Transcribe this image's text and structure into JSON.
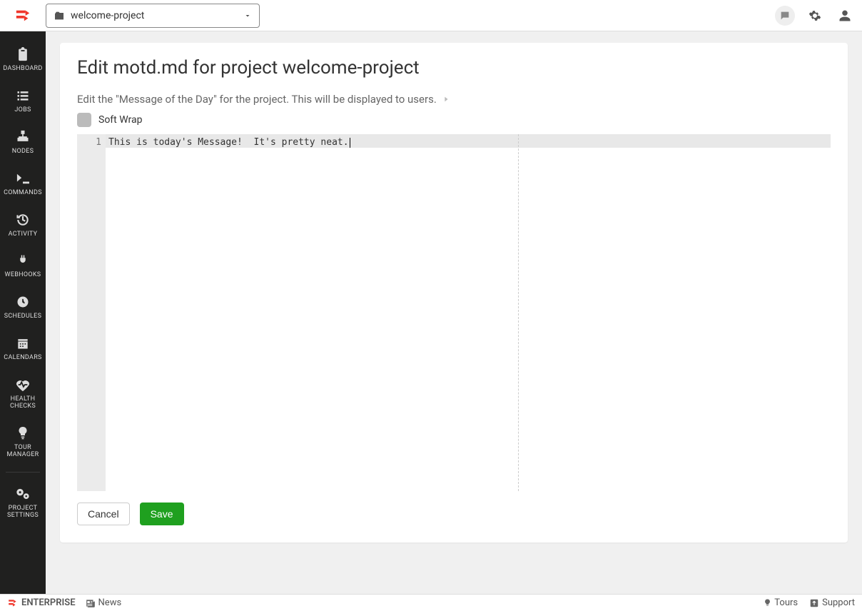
{
  "header": {
    "project_name": "welcome-project"
  },
  "sidebar": {
    "items": [
      {
        "label": "DASHBOARD"
      },
      {
        "label": "JOBS"
      },
      {
        "label": "NODES"
      },
      {
        "label": "COMMANDS"
      },
      {
        "label": "ACTIVITY"
      },
      {
        "label": "WEBHOOKS"
      },
      {
        "label": "SCHEDULES"
      },
      {
        "label": "CALENDARS"
      },
      {
        "label": "HEALTH CHECKS"
      },
      {
        "label": "TOUR MANAGER"
      }
    ],
    "settings_label": "PROJECT SETTINGS"
  },
  "page": {
    "title": "Edit motd.md for project welcome-project",
    "subtitle": "Edit the \"Message of the Day\" for the project. This will be displayed to users.",
    "softwrap_label": "Soft Wrap",
    "editor": {
      "line_number": "1",
      "content": "This is today's Message!  It's pretty neat."
    },
    "buttons": {
      "cancel": "Cancel",
      "save": "Save"
    }
  },
  "footer": {
    "brand": "ENTERPRISE",
    "news": "News",
    "tours": "Tours",
    "support": "Support"
  }
}
